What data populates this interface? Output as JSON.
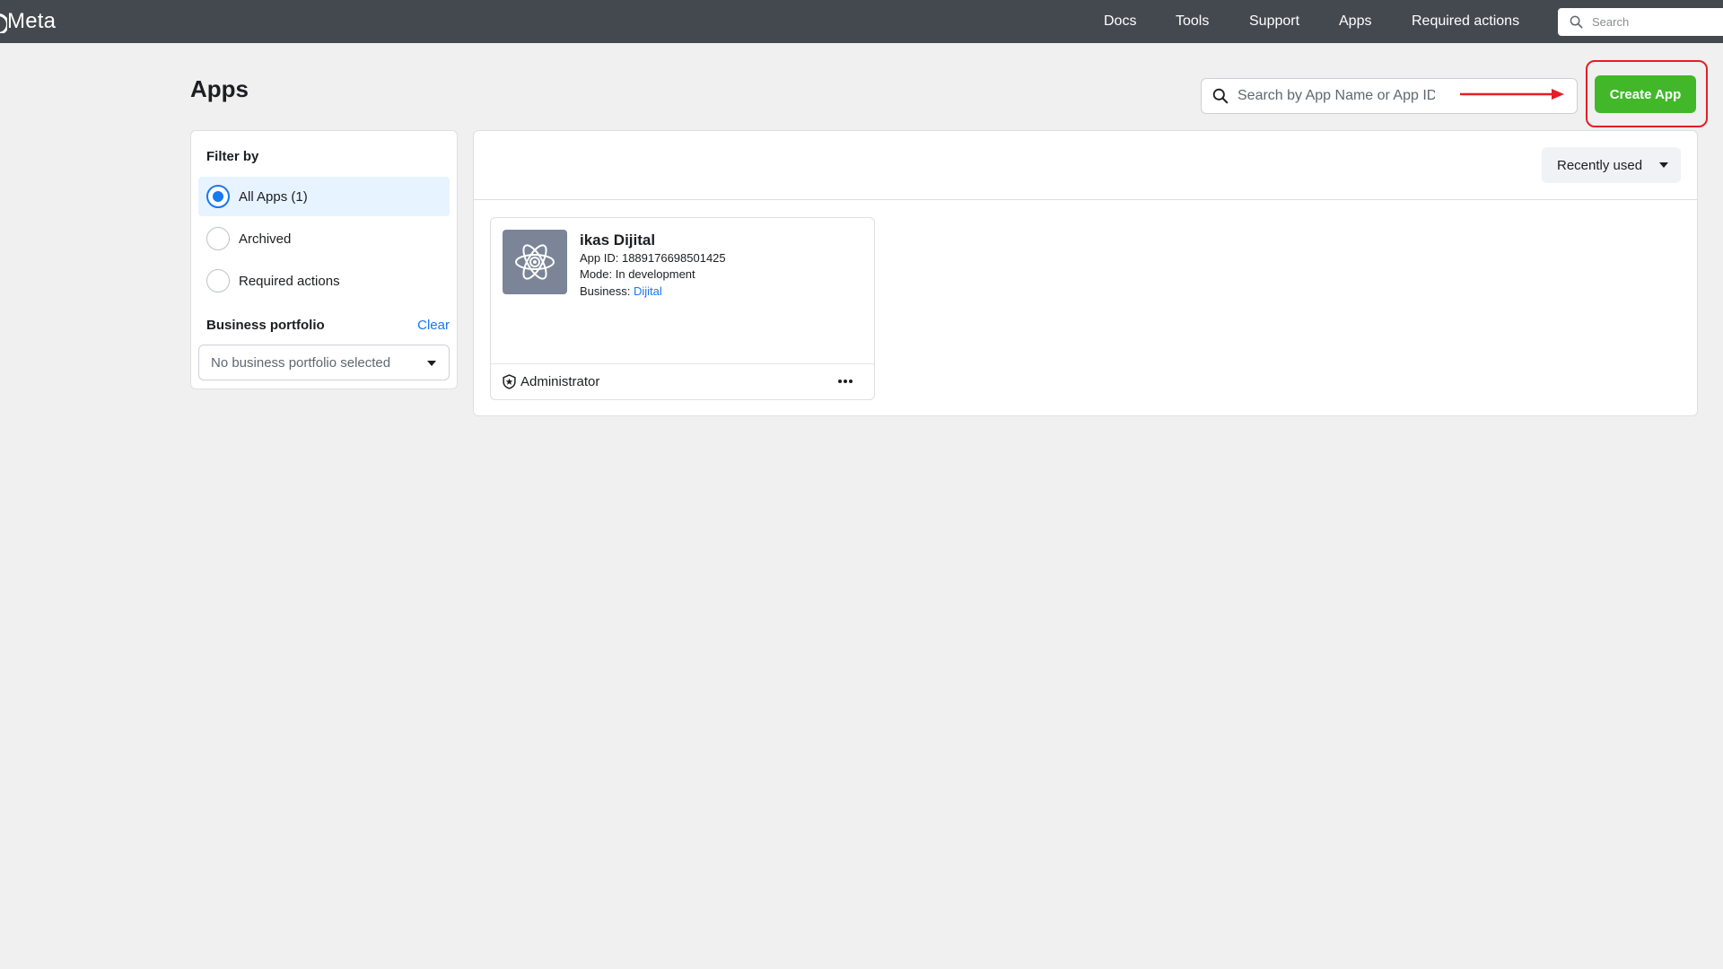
{
  "topbar": {
    "logo_text": "Meta",
    "nav": {
      "docs": "Docs",
      "tools": "Tools",
      "support": "Support",
      "apps": "Apps",
      "required_actions": "Required actions"
    },
    "search_placeholder": "Search"
  },
  "page": {
    "title": "Apps",
    "search_placeholder": "Search by App Name or App ID",
    "create_button": "Create App"
  },
  "filter": {
    "title": "Filter by",
    "options": [
      {
        "label": "All Apps (1)",
        "selected": true
      },
      {
        "label": "Archived",
        "selected": false
      },
      {
        "label": "Required actions",
        "selected": false
      }
    ],
    "business_portfolio": {
      "title": "Business portfolio",
      "clear": "Clear",
      "selected_value": "No business portfolio selected"
    }
  },
  "sort": {
    "label": "Recently used"
  },
  "apps": [
    {
      "name": "ikas Dijital",
      "app_id": "App ID: 1889176698501425",
      "mode": "Mode: In development",
      "business_label": "Business: ",
      "business_name": "Dijital",
      "role": "Administrator"
    }
  ],
  "colors": {
    "topbar": "#444950",
    "accent_green": "#42b72a",
    "link_blue": "#1877f2",
    "highlight_red": "#e41e26"
  },
  "icons": [
    "search-icon",
    "atom-icon",
    "shield-star-icon",
    "more-icon",
    "caret-down-icon",
    "arrow-right-icon"
  ]
}
